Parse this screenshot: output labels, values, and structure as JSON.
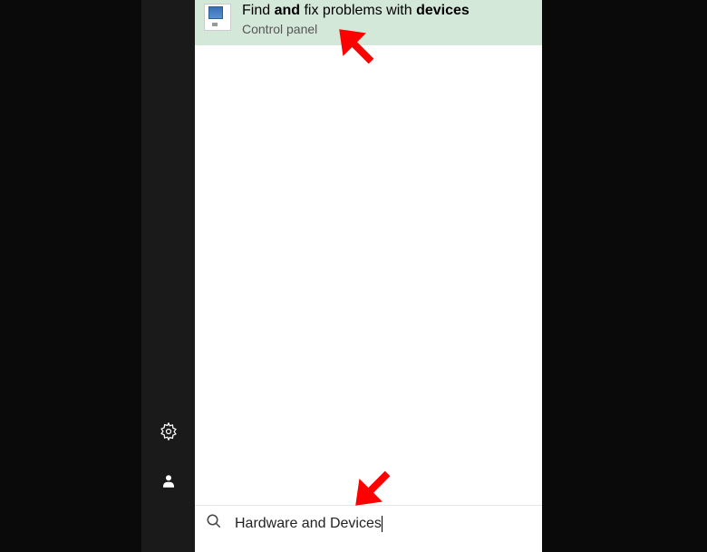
{
  "search_result": {
    "title_part1": "Find ",
    "title_bold1": "and",
    "title_part2": " fix problems with ",
    "title_bold2": "devices",
    "subtitle": "Control panel"
  },
  "search_bar": {
    "query": "Hardware and Devices"
  },
  "sidebar": {
    "settings_label": "Settings",
    "user_label": "User"
  }
}
